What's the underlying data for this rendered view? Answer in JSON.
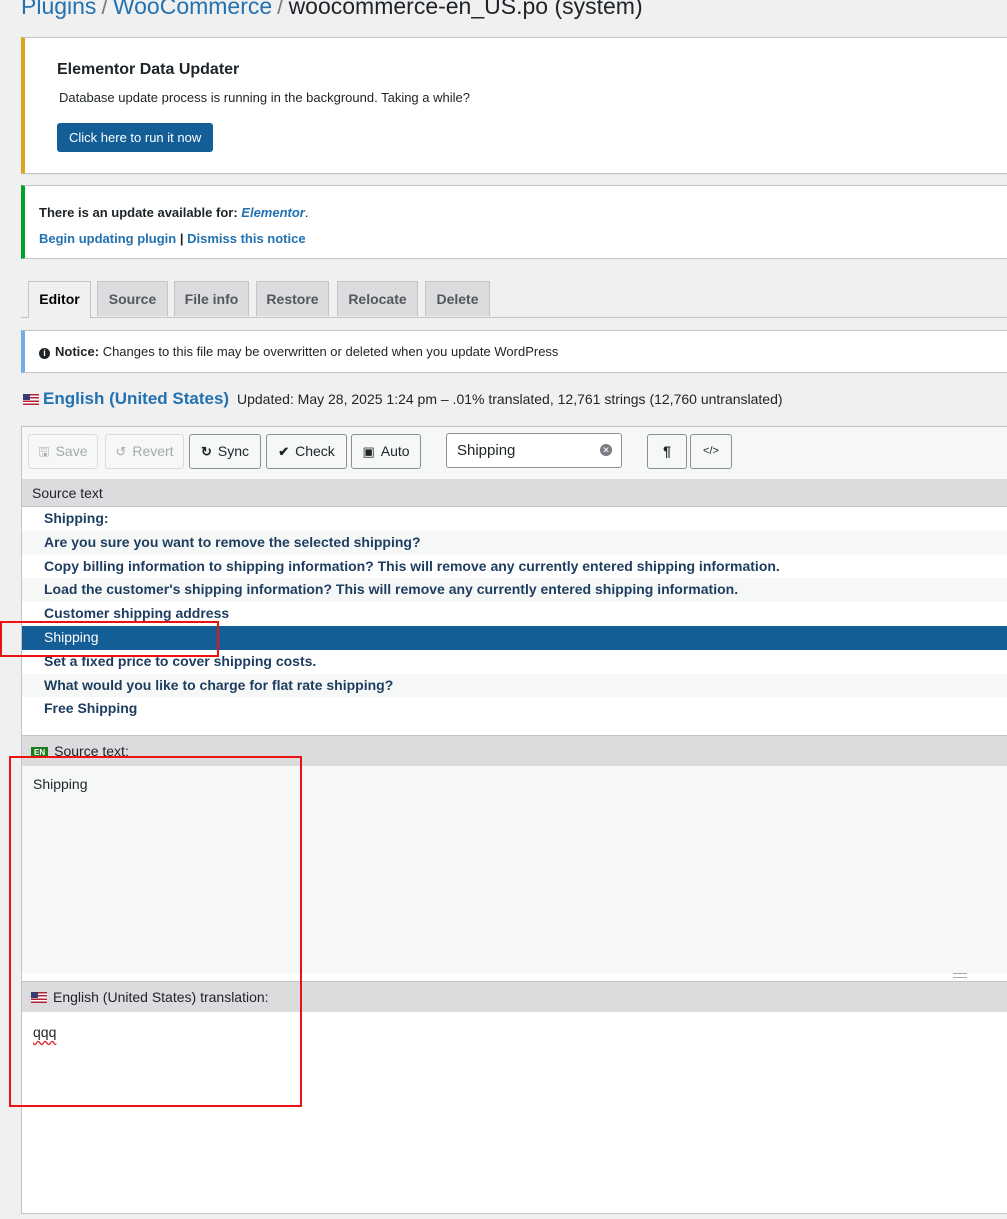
{
  "breadcrumb": {
    "items": [
      "Plugins",
      "WooCommerce"
    ],
    "current": "woocommerce-en_US.po (system)",
    "separator": "/"
  },
  "elementor_notice": {
    "title": "Elementor Data Updater",
    "message": "Database update process is running in the background. Taking a while?",
    "button": "Click here to run it now"
  },
  "update_notice": {
    "text_prefix": "There is an update available for:",
    "plugin": "Elementor",
    "begin_link": "Begin updating plugin",
    "separator": "|",
    "dismiss_link": "Dismiss this notice"
  },
  "tabs": [
    "Editor",
    "Source",
    "File info",
    "Restore",
    "Relocate",
    "Delete"
  ],
  "info_notice": {
    "label": "Notice:",
    "text": "Changes to this file may be overwritten or deleted when you update WordPress"
  },
  "language": {
    "name": "English (United States)",
    "stats": "Updated: May 28, 2025 1:24 pm – .01% translated, 12,761 strings (12,760 untranslated)"
  },
  "toolbar": {
    "save": "Save",
    "revert": "Revert",
    "sync": "Sync",
    "check": "Check",
    "auto": "Auto",
    "search_value": "Shipping",
    "pilcrow": "¶",
    "code": "</>"
  },
  "list": {
    "header": "Source text",
    "rows": [
      "Shipping:",
      "Are you sure you want to remove the selected shipping?",
      "Copy billing information to shipping information? This will remove any currently entered shipping information.",
      "Load the customer's shipping information? This will remove any currently entered shipping information.",
      "Customer shipping address",
      "Shipping",
      "Set a fixed price to cover shipping costs.",
      "What would you like to charge for flat rate shipping?",
      "Free Shipping"
    ],
    "selected_index": 5
  },
  "source_pane": {
    "badge": "EN",
    "label": "Source text:",
    "text": "Shipping"
  },
  "translation_pane": {
    "label": "English (United States) translation:",
    "text": "qqq"
  },
  "colors": {
    "primary": "#135e96",
    "link": "#2271b1",
    "warning": "#dba617",
    "success": "#00a32a",
    "info": "#72aee6",
    "highlight": "#e11111"
  }
}
